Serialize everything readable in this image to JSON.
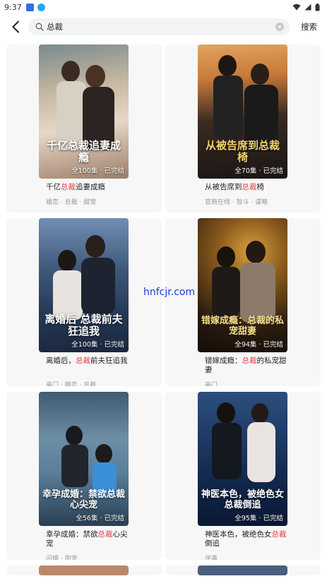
{
  "status_bar": {
    "time": "9:37"
  },
  "search": {
    "query": "总裁",
    "button_label": "搜索"
  },
  "cards": [
    {
      "title_pre": "千亿",
      "title_hl": "总裁",
      "title_post": "追妻成瘾",
      "tags": "婚恋 · 总裁 · 甜宠",
      "episodes": "全100集 · 已完结",
      "cover_text": "千亿总裁追妻成瘾"
    },
    {
      "title_pre": "从被告席到",
      "title_hl": "总裁",
      "title_post": "椅",
      "tags": "官商在线 · 智斗 · 谋略",
      "episodes": "全70集 · 已完结",
      "cover_text": "从被告席到总裁椅"
    },
    {
      "title_pre": "离婚后，",
      "title_hl": "总裁",
      "title_post": "前夫狂追我",
      "tags": "豪门 · 婚恋 · 总裁",
      "episodes": "全100集 · 已完结",
      "cover_text": "离婚后 总裁前夫狂追我"
    },
    {
      "title_pre": "错嫁成瘾：",
      "title_hl": "总裁",
      "title_post": "的私宠甜妻",
      "tags": "豪门",
      "episodes": "全94集 · 已完结",
      "cover_text": "错嫁成瘾：总裁的私宠甜妻"
    },
    {
      "title_pre": "幸孕成婚：禁欲",
      "title_hl": "总裁",
      "title_post": "心尖宠",
      "tags": "闪婚 · 甜宠",
      "episodes": "全56集 · 已完结",
      "cover_text": "幸孕成婚：禁欲总裁心尖宠"
    },
    {
      "title_pre": "神医本色，被绝色女",
      "title_hl": "总裁",
      "title_post": "倒追",
      "tags": "逆袭",
      "episodes": "全95集 · 已完结",
      "cover_text": "神医本色，被绝色女总裁倒追"
    }
  ],
  "watermark": "hnfcjr.com",
  "colors": {
    "highlight": "#e23b3b",
    "card_bg": "#f7f7f8",
    "search_bg": "#f2f3f5"
  }
}
